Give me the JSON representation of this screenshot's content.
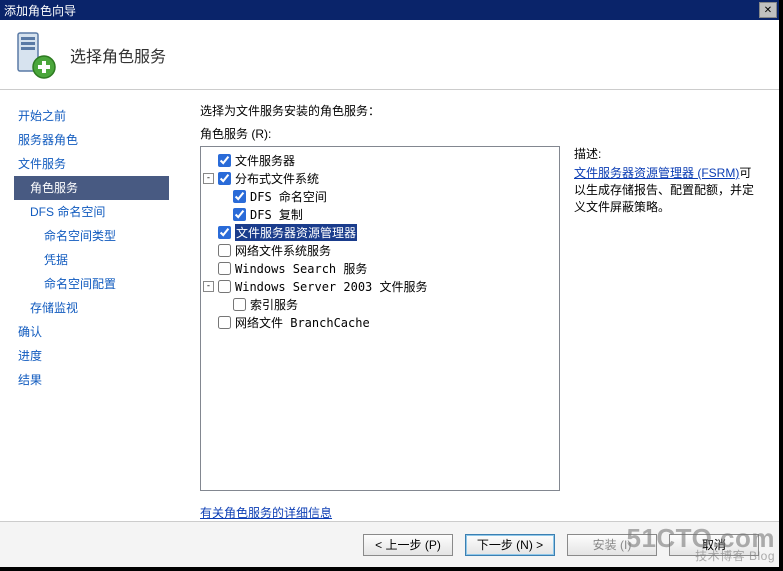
{
  "window": {
    "title": "添加角色向导"
  },
  "header": {
    "title": "选择角色服务"
  },
  "sidebar": {
    "items": [
      {
        "label": "开始之前"
      },
      {
        "label": "服务器角色"
      },
      {
        "label": "文件服务"
      },
      {
        "label": "角色服务",
        "current": true,
        "indent": 1
      },
      {
        "label": "DFS 命名空间",
        "indent": 1
      },
      {
        "label": "命名空间类型",
        "indent": 2
      },
      {
        "label": "凭据",
        "indent": 2
      },
      {
        "label": "命名空间配置",
        "indent": 2
      },
      {
        "label": "存储监视",
        "indent": 1
      },
      {
        "label": "确认"
      },
      {
        "label": "进度"
      },
      {
        "label": "结果"
      }
    ]
  },
  "content": {
    "instruction": "选择为文件服务安装的角色服务：",
    "roleServicesLabel": "角色服务 (R):",
    "tree": [
      {
        "depth": 0,
        "toggle": null,
        "checked": true,
        "label": "文件服务器"
      },
      {
        "depth": 0,
        "toggle": "-",
        "checked": true,
        "label": "分布式文件系统"
      },
      {
        "depth": 1,
        "toggle": null,
        "checked": true,
        "label": "DFS 命名空间"
      },
      {
        "depth": 1,
        "toggle": null,
        "checked": true,
        "label": "DFS 复制"
      },
      {
        "depth": 0,
        "toggle": null,
        "checked": true,
        "label": "文件服务器资源管理器",
        "selected": true
      },
      {
        "depth": 0,
        "toggle": null,
        "checked": false,
        "label": "网络文件系统服务"
      },
      {
        "depth": 0,
        "toggle": null,
        "checked": false,
        "label": "Windows Search 服务"
      },
      {
        "depth": 0,
        "toggle": "-",
        "checked": false,
        "label": "Windows Server 2003 文件服务"
      },
      {
        "depth": 1,
        "toggle": null,
        "checked": false,
        "label": "索引服务"
      },
      {
        "depth": 0,
        "toggle": null,
        "checked": false,
        "label": "网络文件 BranchCache"
      }
    ],
    "descTitle": "描述:",
    "descLink": "文件服务器资源管理器 (FSRM)",
    "descRest": "可以生成存储报告、配置配额，并定义文件屏蔽策略。",
    "moreInfo": "有关角色服务的详细信息"
  },
  "footer": {
    "prev": "< 上一步 (P)",
    "next": "下一步 (N) >",
    "install": "安装 (I)",
    "cancel": "取消"
  },
  "watermark": {
    "big": "51CTO.com",
    "small": "技术博客   Blog"
  }
}
